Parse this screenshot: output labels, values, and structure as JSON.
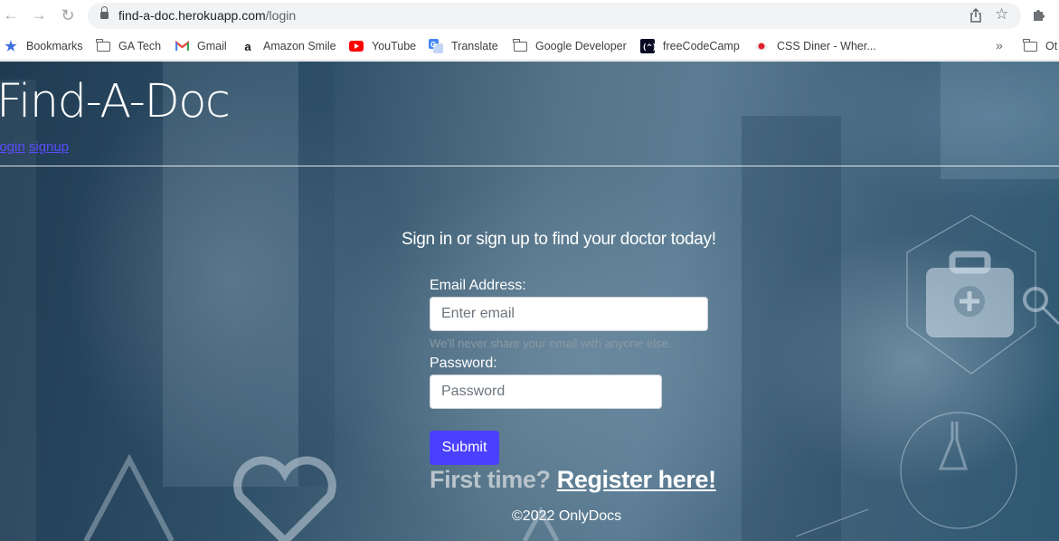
{
  "browser": {
    "url_host": "find-a-doc.herokuapp.com",
    "url_path": "/login",
    "bookmarks": [
      {
        "label": "Bookmarks",
        "icon": "star-icon"
      },
      {
        "label": "GA Tech",
        "icon": "folder-icon"
      },
      {
        "label": "Gmail",
        "icon": "gmail-icon"
      },
      {
        "label": "Amazon Smile",
        "icon": "amazon-icon"
      },
      {
        "label": "YouTube",
        "icon": "youtube-icon"
      },
      {
        "label": "Translate",
        "icon": "translate-icon"
      },
      {
        "label": "Google Developer",
        "icon": "folder-icon"
      },
      {
        "label": "freeCodeCamp",
        "icon": "freecodecamp-icon"
      },
      {
        "label": "CSS Diner - Wher...",
        "icon": "css-diner-icon"
      },
      {
        "label": "Ot",
        "icon": "folder-icon"
      }
    ],
    "more_label": "»"
  },
  "site": {
    "title": "Find-A-Doc",
    "nav": {
      "login": "login",
      "signup": "signup"
    }
  },
  "form": {
    "tagline": "Sign in or sign up to find your doctor today!",
    "email_label": "Email Address:",
    "email_placeholder": "Enter email",
    "email_help": "We'll never share your email with anyone else.",
    "password_label": "Password:",
    "password_placeholder": "Password",
    "submit_label": "Submit",
    "first_time": "First time?",
    "register_link": "Register here!"
  },
  "footer": {
    "text": "©2022 OnlyDocs"
  },
  "colors": {
    "accent": "#4a40ff",
    "link": "#5a4dff",
    "background": "#2f5069"
  }
}
